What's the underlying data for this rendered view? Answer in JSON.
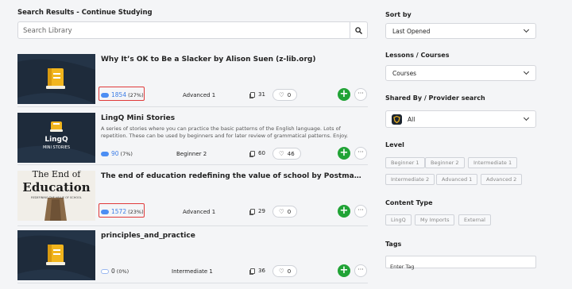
{
  "header": {
    "title": "Search Results - Continue Studying",
    "search_placeholder": "Search Library",
    "search_icon": "search-icon"
  },
  "results": [
    {
      "title": "Why It’s OK to Be a Slacker by Alison Suen (z-lib.org)",
      "description": "",
      "known_words": "1854",
      "known_pct": "(27%)",
      "level": "Advanced 1",
      "lessons": "31",
      "likes": "0",
      "highlighted": true
    },
    {
      "title": "LingQ Mini Stories",
      "description": "A series of stories where you can practice the basic patterns of the English language. Lots of repetition. These can be used by beginners and for later review of grammatical patterns. Enjoy.",
      "known_words": "90",
      "known_pct": "(7%)",
      "level": "Beginner 2",
      "lessons": "60",
      "likes": "46",
      "highlighted": false,
      "thumb_brand": "LingQ",
      "thumb_caption": "MINI STORIES"
    },
    {
      "title": "The end of education redefining the value of school by Postman, Neil (…",
      "description": "",
      "known_words": "1572",
      "known_pct": "(23%)",
      "level": "Advanced 1",
      "lessons": "29",
      "likes": "0",
      "highlighted": true,
      "thumb_line1": "The End of",
      "thumb_line2": "Education",
      "thumb_subtitle": "REDEFINING THE VALUE OF SCHOOL"
    },
    {
      "title": "principles_and_practice",
      "description": "",
      "known_words": "0",
      "known_pct": "(0%)",
      "level": "Intermediate 1",
      "lessons": "36",
      "likes": "0",
      "highlighted": false
    }
  ],
  "sidebar": {
    "sort_label": "Sort by",
    "sort_value": "Last Opened",
    "lessons_label": "Lessons / Courses",
    "lessons_value": "Courses",
    "shared_label": "Shared By / Provider search",
    "shared_value": "All",
    "level_label": "Level",
    "levels": [
      "Beginner 1",
      "Beginner 2",
      "Intermediate 1",
      "Intermediate 2",
      "Advanced 1",
      "Advanced 2"
    ],
    "content_label": "Content Type",
    "content_types": [
      "LingQ",
      "My Imports",
      "External"
    ],
    "tags_label": "Tags",
    "tags_placeholder": "Enter Tag"
  },
  "colors": {
    "accent_blue": "#4c8ef3",
    "add_green": "#21a336",
    "highlight_red": "#e03a3a",
    "thumb_dark": "#1e2b3b",
    "book_yellow": "#f2b51d"
  }
}
